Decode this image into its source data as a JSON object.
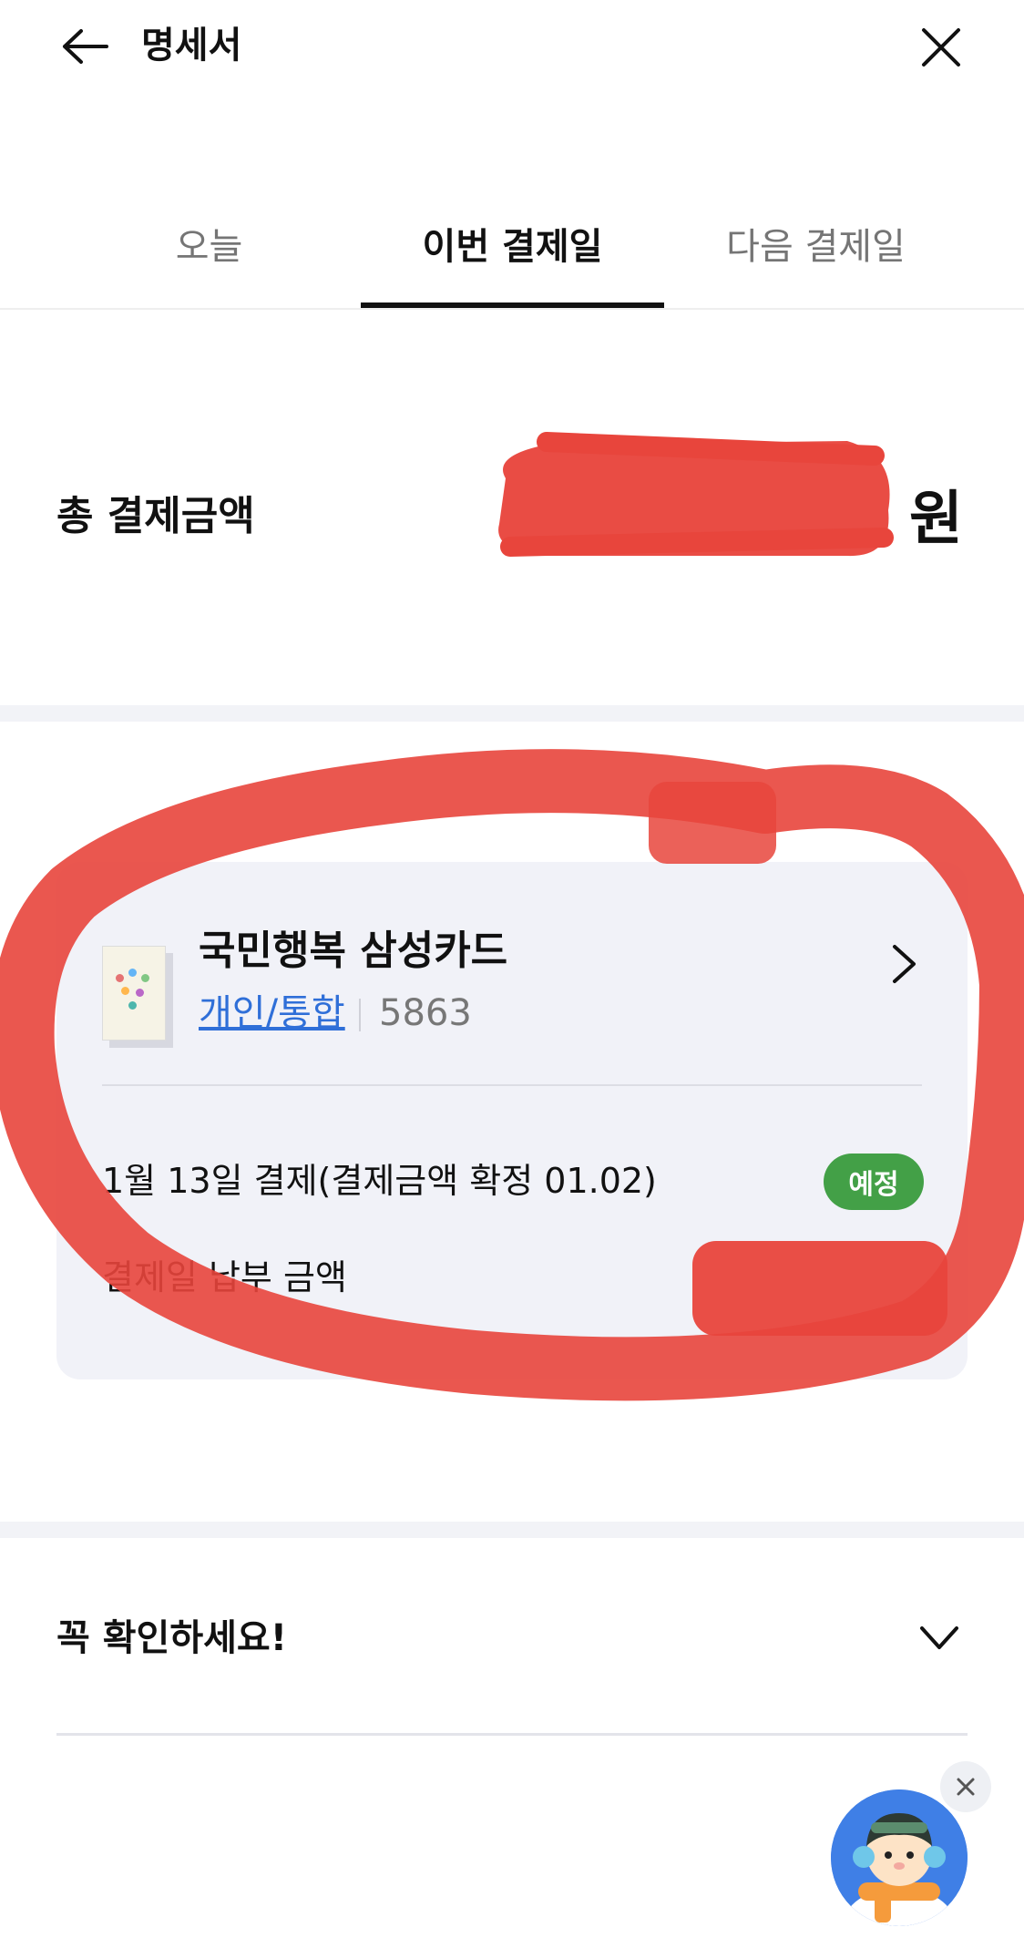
{
  "header": {
    "title": "명세서",
    "back_icon": "arrow-left-icon",
    "close_icon": "close-icon"
  },
  "tabs": [
    {
      "label": "오늘",
      "active": false
    },
    {
      "label": "이번 결제일",
      "active": true
    },
    {
      "label": "다음 결제일",
      "active": false
    }
  ],
  "total": {
    "label": "총 결제금액",
    "amount": "",
    "unit": "원"
  },
  "card": {
    "name": "국민행복 삼성카드",
    "type": "개인/통합",
    "number": "5863",
    "payment_info": "1월 13일 결제(결제금액 확정 01.02)",
    "status_badge": "예정",
    "amount_label": "결제일 납부 금액",
    "amount": ""
  },
  "notice": {
    "label": "꼭 확인하세요!",
    "icon": "chevron-down-icon"
  },
  "colors": {
    "accent_link": "#2f6fd8",
    "badge_green": "#43a047",
    "redaction_red": "#e8453c",
    "card_bg": "#f1f2f8",
    "avatar_bg": "#3f7fe6"
  }
}
